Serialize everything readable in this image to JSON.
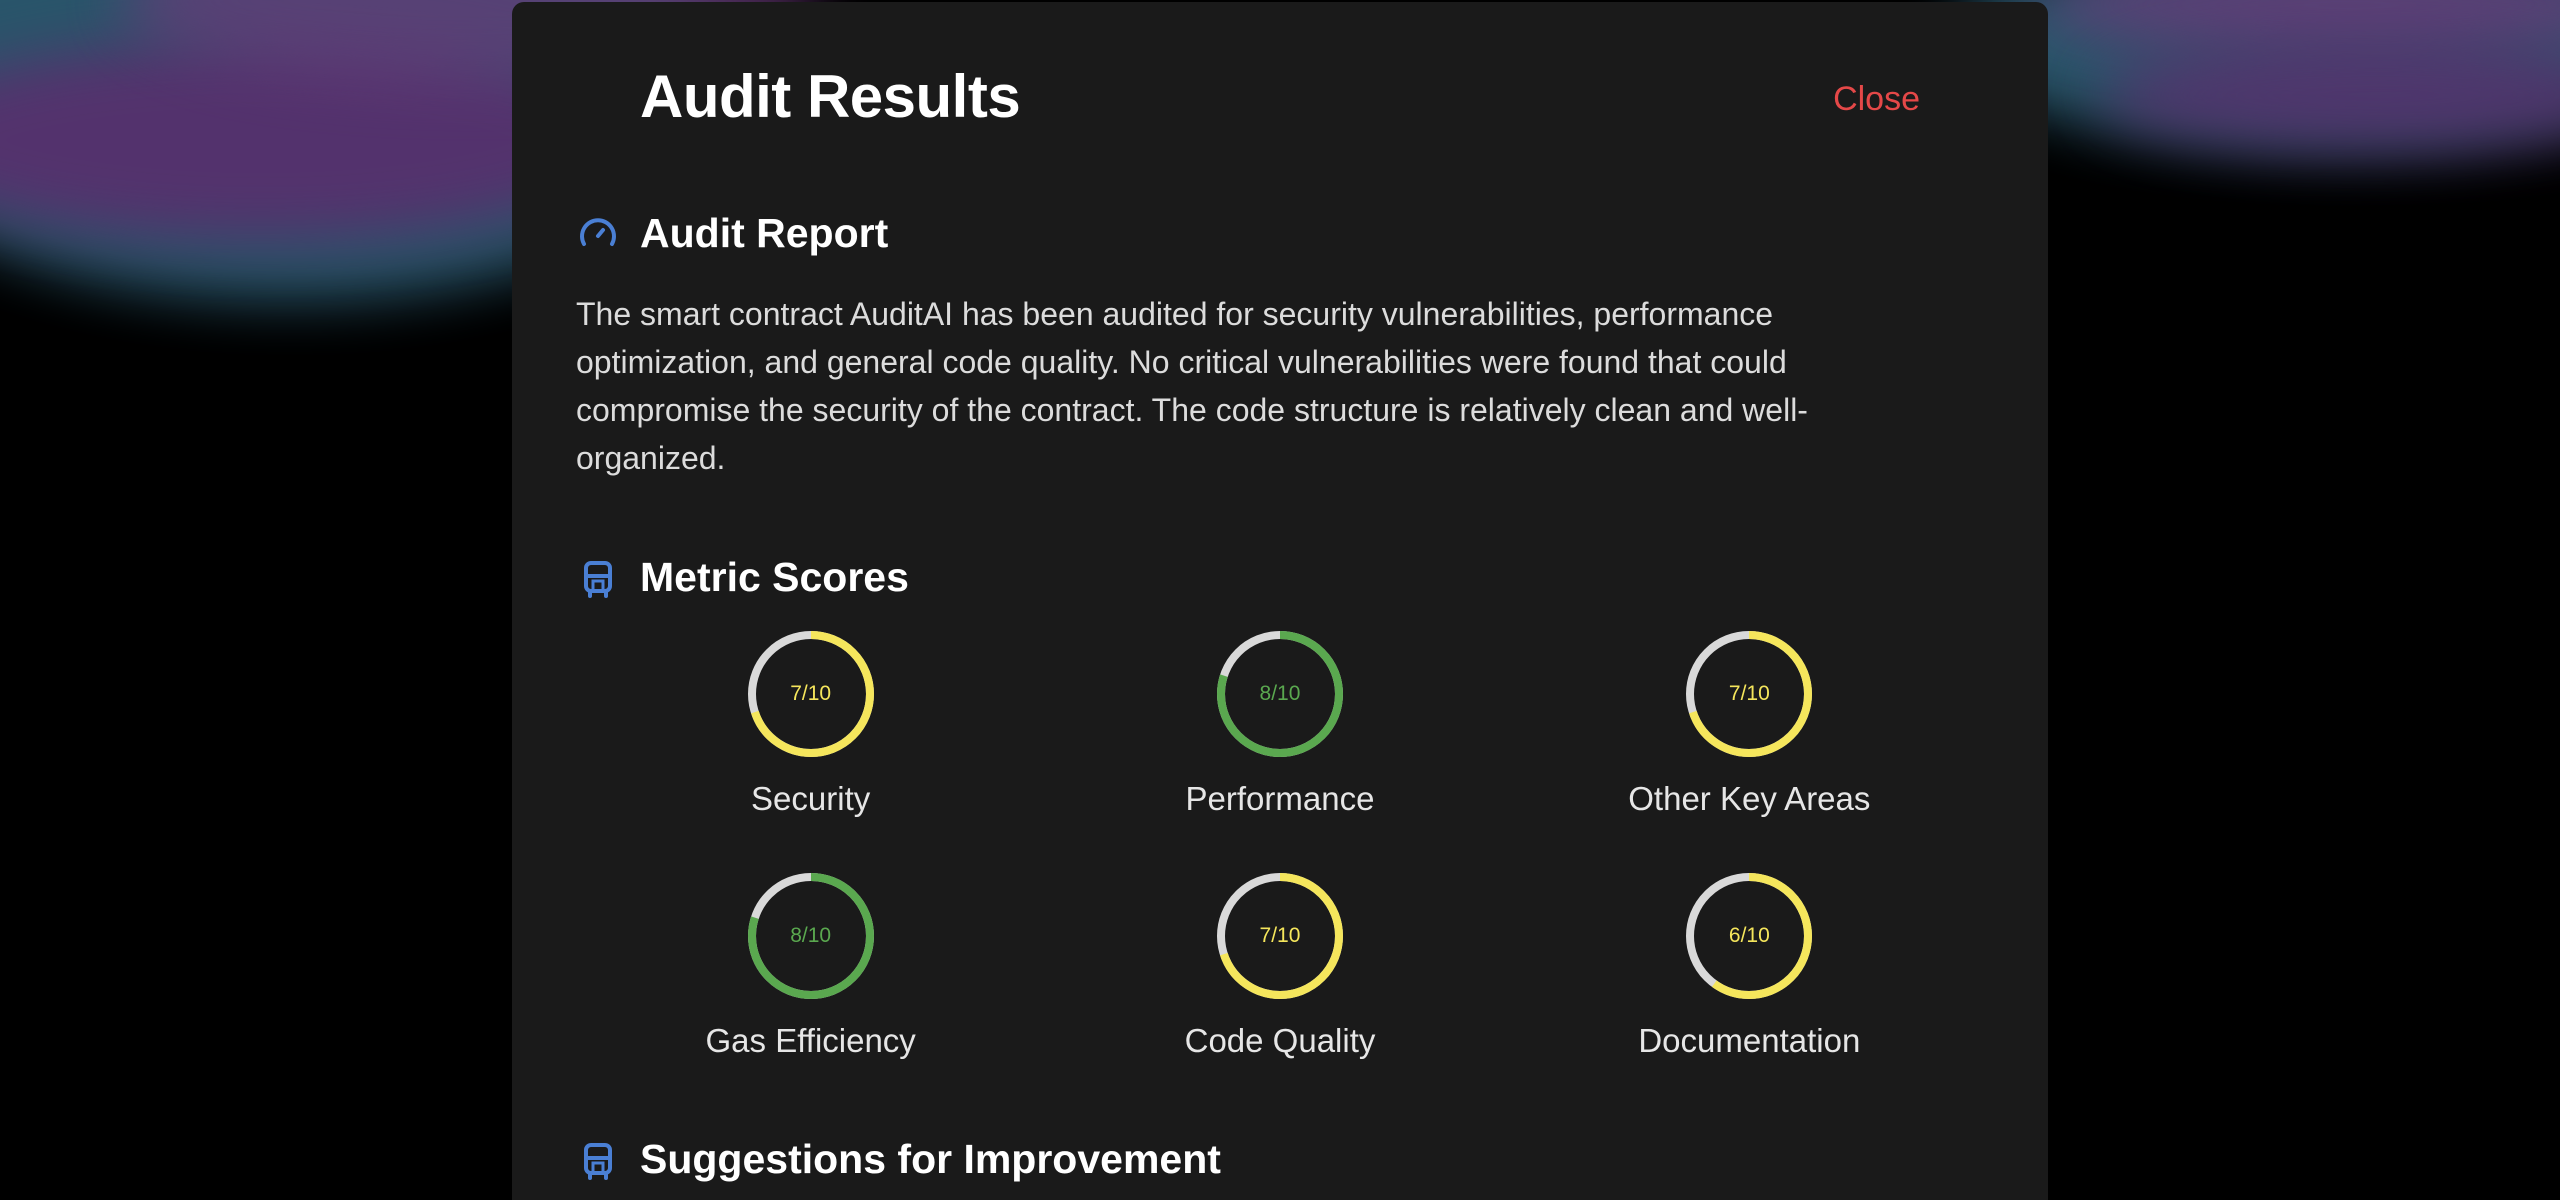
{
  "modal": {
    "title": "Audit Results",
    "close_label": "Close"
  },
  "report": {
    "heading": "Audit Report",
    "icon": "gauge-icon",
    "text": "The smart contract AuditAI has been audited for security vulnerabilities, performance optimization, and general code quality. No critical vulnerabilities were found that could compromise the security of the contract. The code structure is relatively clean and well-organized."
  },
  "metrics": {
    "heading": "Metric Scores",
    "icon": "chip-icon",
    "items": [
      {
        "label": "Security",
        "score_text": "7/10",
        "score": 7,
        "max": 10,
        "color": "#f5e65c"
      },
      {
        "label": "Performance",
        "score_text": "8/10",
        "score": 8,
        "max": 10,
        "color": "#5aa84f"
      },
      {
        "label": "Other Key Areas",
        "score_text": "7/10",
        "score": 7,
        "max": 10,
        "color": "#f5e65c"
      },
      {
        "label": "Gas Efficiency",
        "score_text": "8/10",
        "score": 8,
        "max": 10,
        "color": "#5aa84f"
      },
      {
        "label": "Code Quality",
        "score_text": "7/10",
        "score": 7,
        "max": 10,
        "color": "#f5e65c"
      },
      {
        "label": "Documentation",
        "score_text": "6/10",
        "score": 6,
        "max": 10,
        "color": "#f5e65c"
      }
    ]
  },
  "suggestions": {
    "heading": "Suggestions for Improvement",
    "icon": "chip-icon"
  },
  "colors": {
    "accent": "#4a7fd4",
    "close": "#e54848",
    "track": "#d9d9d9"
  }
}
